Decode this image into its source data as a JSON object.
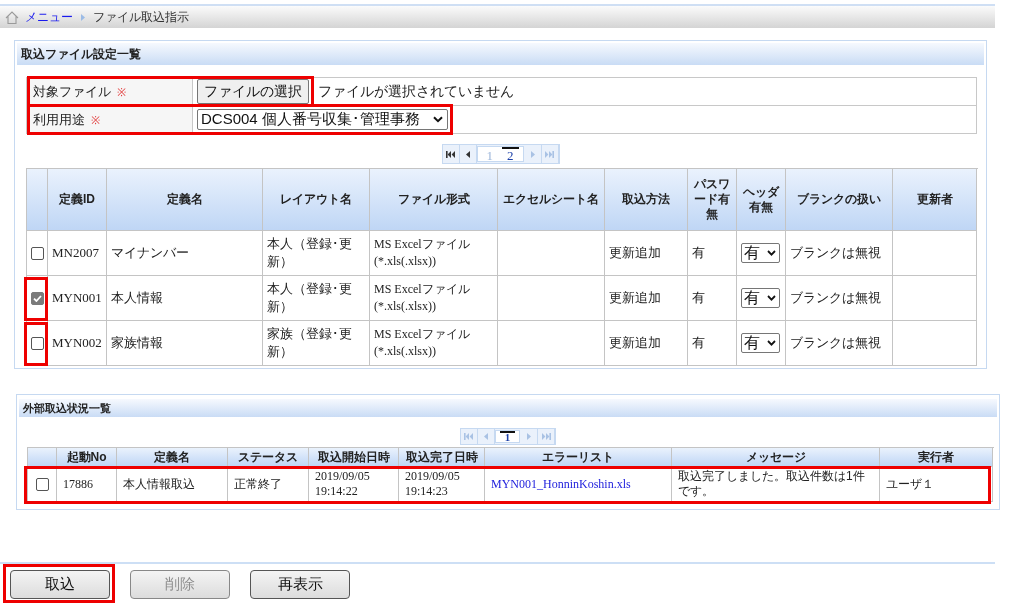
{
  "breadcrumb": [
    {
      "kind": "link",
      "label": "メニュー"
    },
    {
      "kind": "current",
      "label": "ファイル取込指示"
    }
  ],
  "import_settings": {
    "title": "取込ファイル設定一覧",
    "form": [
      {
        "kind": "file",
        "label": "対象ファイル",
        "required_mark": "※",
        "button": "ファイルの選択",
        "status": "ファイルが選択されていません",
        "highlighted": true
      },
      {
        "kind": "select",
        "label": "利用用途",
        "required_mark": "※",
        "value": "DCS004 個人番号収集･管理事務",
        "highlighted": true
      }
    ],
    "pager": {
      "back": [
        {
          "kind": "first",
          "disabled": false
        },
        {
          "kind": "prev",
          "disabled": false
        }
      ],
      "pages": [
        {
          "label": "1",
          "selected": false
        },
        {
          "label": "2",
          "selected": true
        }
      ],
      "forward": [
        {
          "kind": "next",
          "disabled": true
        },
        {
          "kind": "last",
          "disabled": true
        }
      ]
    },
    "table": {
      "columns": [
        "定義ID",
        "定義名",
        "レイアウト名",
        "ファイル形式",
        "エクセルシート名",
        "取込方法",
        "パスワード有無",
        "ヘッダ有無",
        "ブランクの扱い",
        "更新者"
      ],
      "rows": [
        {
          "checked": false,
          "highlighted": false,
          "definition_id": "MN2007",
          "definition_name": "マイナンバー",
          "layout_name": "本人（登録･更新）",
          "file_format": "MS Excelファイル(*.xls(.xlsx))",
          "import_method": "更新追加",
          "password": "有",
          "header": "有",
          "blank_handling": "ブランクは無視"
        },
        {
          "checked": true,
          "highlighted": true,
          "definition_id": "MYN001",
          "definition_name": "本人情報",
          "layout_name": "本人（登録･更新）",
          "file_format": "MS Excelファイル(*.xls(.xlsx))",
          "import_method": "更新追加",
          "password": "有",
          "header": "有",
          "blank_handling": "ブランクは無視"
        },
        {
          "checked": false,
          "highlighted": true,
          "definition_id": "MYN002",
          "definition_name": "家族情報",
          "layout_name": "家族（登録･更新）",
          "file_format": "MS Excelファイル(*.xls(.xlsx))",
          "import_method": "更新追加",
          "password": "有",
          "header": "有",
          "blank_handling": "ブランクは無視"
        }
      ]
    }
  },
  "import_status": {
    "title": "外部取込状況一覧",
    "pager": {
      "back": [
        {
          "kind": "first",
          "disabled": true
        },
        {
          "kind": "prev",
          "disabled": true
        }
      ],
      "pages": [
        {
          "label": "1",
          "selected": true
        }
      ],
      "forward": [
        {
          "kind": "next",
          "disabled": true
        },
        {
          "kind": "last",
          "disabled": true
        }
      ]
    },
    "table": {
      "columns": [
        "起動No",
        "定義名",
        "ステータス",
        "取込開始日時",
        "取込完了日時",
        "エラーリスト",
        "メッセージ",
        "実行者"
      ],
      "rows": [
        {
          "checked": false,
          "highlighted": true,
          "launch_no": "17886",
          "definition_name": "本人情報取込",
          "status": "正常終了",
          "start_time": "2019/09/05 19:14:22",
          "end_time": "2019/09/05 19:14:23",
          "error_list": "MYN001_HonninKoshin.xls",
          "message": "取込完了しました。取込件数は1件です。",
          "executor": "ユーザ１"
        }
      ]
    }
  },
  "buttons": [
    {
      "label": "取込",
      "disabled": false,
      "highlighted": true
    },
    {
      "label": "削除",
      "disabled": true,
      "highlighted": false
    },
    {
      "label": "再表示",
      "disabled": false,
      "highlighted": false
    }
  ]
}
